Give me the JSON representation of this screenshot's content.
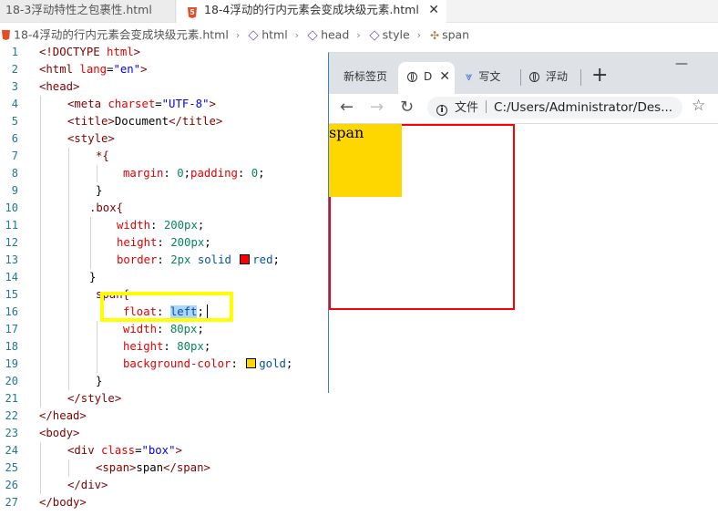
{
  "editor": {
    "tabs": [
      {
        "label": "18-3浮动特性之包裹性.html",
        "active": false
      },
      {
        "label": "18-4浮动的行内元素会变成块级元素.html",
        "active": true
      }
    ],
    "breadcrumb": [
      "18-4浮动的行内元素会变成块级元素.html",
      "html",
      "head",
      "style",
      "span"
    ],
    "line_numbers": [
      "1",
      "2",
      "3",
      "4",
      "5",
      "6",
      "7",
      "8",
      "9",
      "10",
      "11",
      "12",
      "13",
      "14",
      "15",
      "16",
      "17",
      "18",
      "19",
      "20",
      "21",
      "22",
      "23",
      "24",
      "25",
      "26",
      "27"
    ],
    "code": {
      "l1_a": "<!DOCTYPE ",
      "l1_b": "html",
      "l1_c": ">",
      "l2_a": "<html ",
      "l2_b": "lang",
      "l2_c": "=",
      "l2_d": "\"en\"",
      "l2_e": ">",
      "l3": "<head>",
      "l4_a": "<meta ",
      "l4_b": "charset",
      "l4_c": "=",
      "l4_d": "\"UTF-8\"",
      "l4_e": ">",
      "l5_a": "<title>",
      "l5_b": "Document",
      "l5_c": "</title>",
      "l6": "<style>",
      "l7": "*{",
      "l8_a": "margin",
      "l8_b": ": ",
      "l8_c": "0",
      "l8_d": ";",
      "l8_e": "padding",
      "l8_f": ": ",
      "l8_g": "0",
      "l8_h": ";",
      "l9": "}",
      "l10": ".box{",
      "l11_a": "width",
      "l11_b": ": ",
      "l11_c": "200px",
      "l11_d": ";",
      "l12_a": "height",
      "l12_b": ": ",
      "l12_c": "200px",
      "l12_d": ";",
      "l13_a": "border",
      "l13_b": ": ",
      "l13_c": "2px",
      "l13_d": " solid ",
      "l13_e": "red",
      "l13_f": ";",
      "l14": "}",
      "l15": "span{",
      "l16_a": "float",
      "l16_b": ": ",
      "l16_c": "left",
      "l16_d": ";",
      "l17_a": "width",
      "l17_b": ": ",
      "l17_c": "80px",
      "l17_d": ";",
      "l18_a": "height",
      "l18_b": ": ",
      "l18_c": "80px",
      "l18_d": ";",
      "l19_a": "background-color",
      "l19_b": ": ",
      "l19_c": "gold",
      "l19_d": ";",
      "l20": "}",
      "l21": "</style>",
      "l22": "</head>",
      "l23": "<body>",
      "l24_a": "<div ",
      "l24_b": "class",
      "l24_c": "=",
      "l24_d": "\"box\"",
      "l24_e": ">",
      "l25_a": "<span>",
      "l25_b": "span",
      "l25_c": "</span>",
      "l26": "</div>",
      "l27": "</body>"
    },
    "swatch_colors": {
      "red": "#ff0000",
      "gold": "#ffd700"
    },
    "highlight_color": "#ffff00"
  },
  "browser": {
    "tabs": [
      {
        "label": "新标签页",
        "icon": "none"
      },
      {
        "label": "D",
        "icon": "globe-icon",
        "active": true
      },
      {
        "label": "写文",
        "icon": "double-chevron-icon"
      },
      {
        "label": "浮动",
        "icon": "globe-icon"
      }
    ],
    "new_tab": "+",
    "minimize": "—",
    "address_label": "文件",
    "address": "C:/Users/Administrator/Des...",
    "page": {
      "span_text": "span",
      "box_border": "#ff0000",
      "span_bg": "#ffd700"
    }
  }
}
